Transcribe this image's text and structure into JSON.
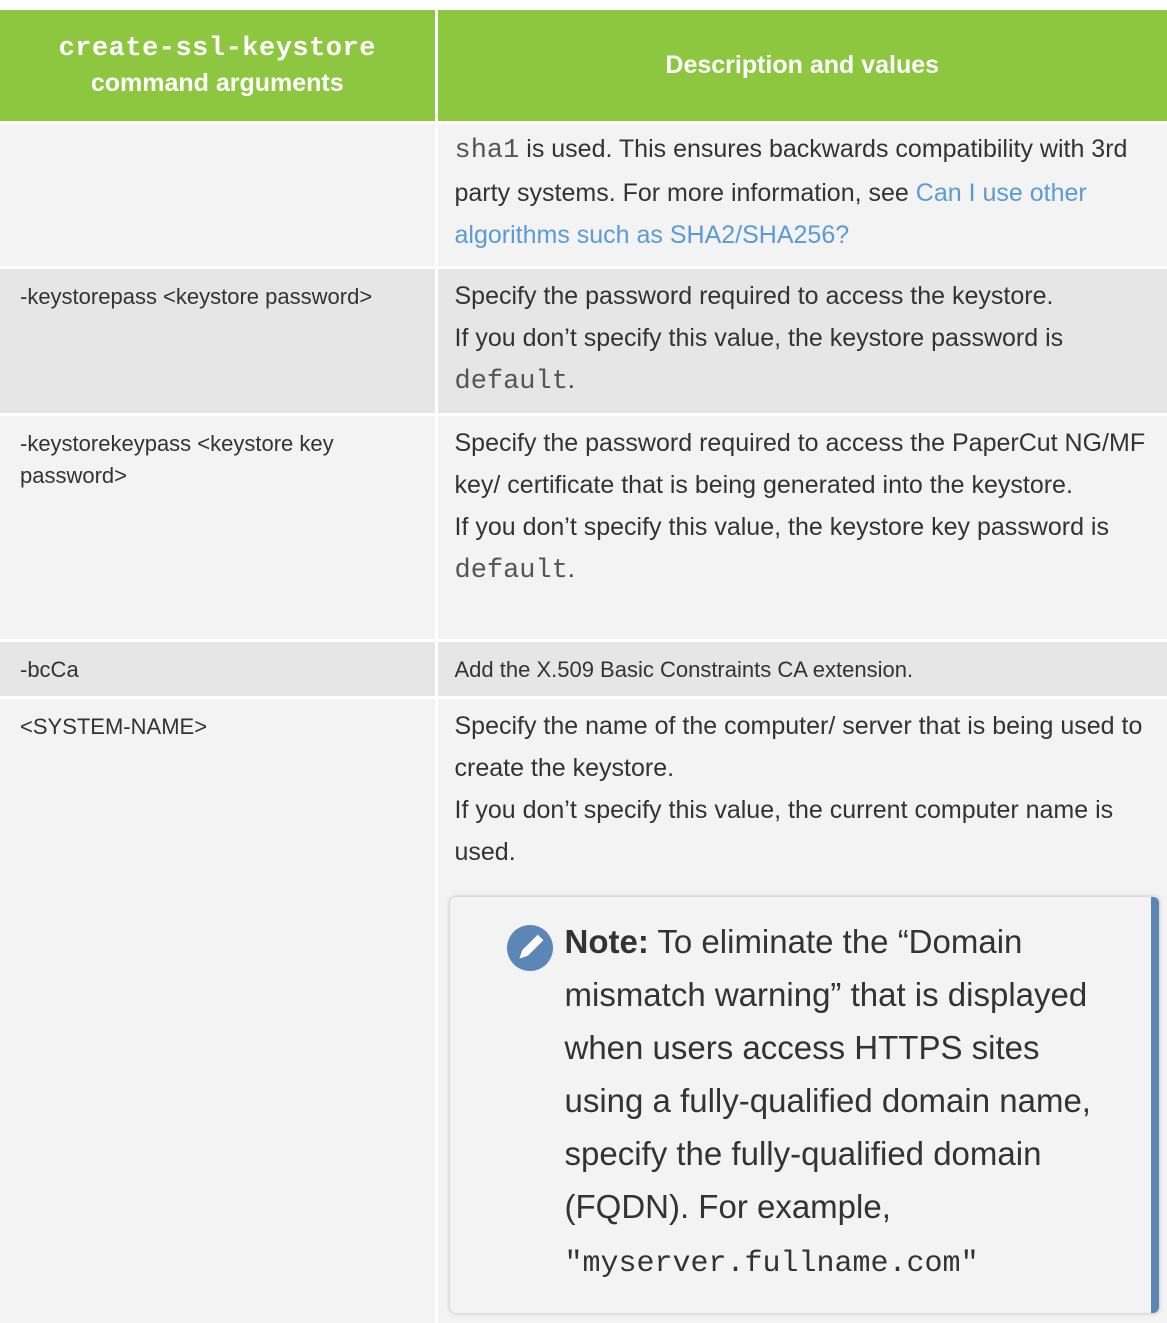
{
  "table": {
    "header": {
      "col1_code": "create-ssl-keystore",
      "col1_label": "command arguments",
      "col2_label": "Description and values"
    },
    "rows": [
      {
        "arg": "",
        "desc_code_start": "sha1",
        "desc_text": " is used. This ensures backwards compatibility with 3rd party systems. For more information, see ",
        "desc_link": "Can I use other algorithms such as SHA2/SHA256?"
      },
      {
        "arg": "-keystorepass <keystore password>",
        "desc_line1": "Specify the password required to access the keystore.",
        "desc_line2": "If you don’t specify this value, the keystore password is ",
        "desc_code": "default",
        "desc_end": "."
      },
      {
        "arg": "-keystorekeypass <keystore key password>",
        "desc_line1": "Specify the password required to access the PaperCut NG/MF key/ certificate that is being generated into the keystore.",
        "desc_line2": "If you don’t specify this value, the keystore key password is ",
        "desc_code": "default",
        "desc_end": "."
      },
      {
        "arg": "-bcCa",
        "desc": "Add the X.509 Basic Constraints CA extension."
      },
      {
        "arg": "<SYSTEM-NAME>",
        "desc_line1": "Specify the name of the computer/ server that is being used to create the keystore.",
        "desc_line2": "If you don’t specify this value, the current computer name is used.",
        "note": {
          "label": "Note:",
          "text": " To eliminate the “Domain mismatch warning” that is displayed when users access HTTPS sites using a fully-qualified domain name, specify the fully-qualified domain (FQDN). For example,",
          "code": "\"myserver.fullname.com\"",
          "icon": "pencil-icon"
        }
      }
    ]
  },
  "colors": {
    "header_bg": "#8dc63f",
    "link": "#5b9bd5",
    "note_accent": "#5b86b6"
  }
}
